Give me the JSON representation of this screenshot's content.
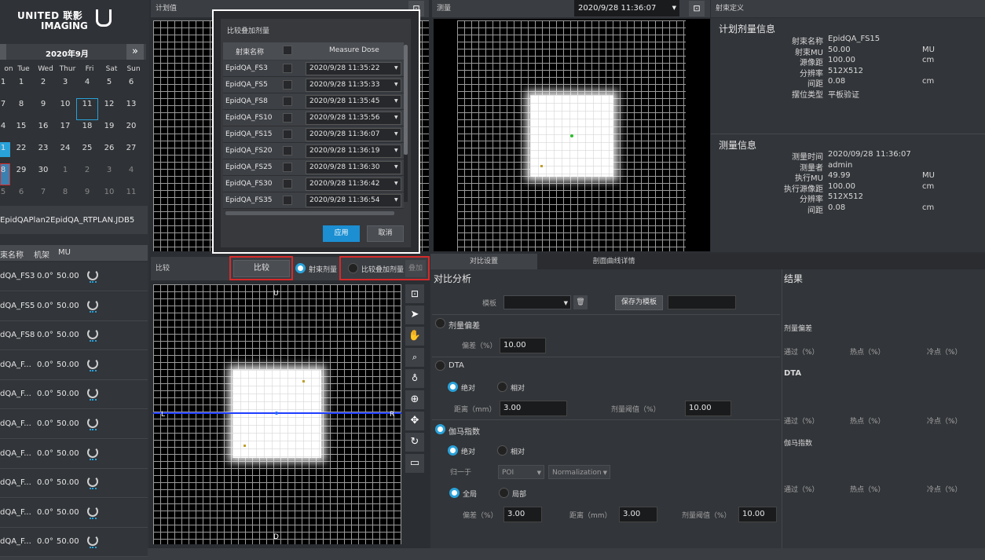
{
  "brand": {
    "line1": "UNITED 联影",
    "line2": "IMAGING"
  },
  "calendar": {
    "month_label": "2020年9月",
    "next_icon": "»",
    "weekdays": [
      "on",
      "Tue",
      "Wed",
      "Thur",
      "Fri",
      "Sat",
      "Sun"
    ],
    "rows": [
      [
        "1",
        "1",
        "2",
        "3",
        "4",
        "5",
        "6"
      ],
      [
        "7",
        "8",
        "9",
        "10",
        "11",
        "12",
        "13"
      ],
      [
        "4",
        "15",
        "16",
        "17",
        "18",
        "19",
        "20"
      ],
      [
        "1",
        "22",
        "23",
        "24",
        "25",
        "26",
        "27"
      ],
      [
        "8",
        "29",
        "30",
        "1",
        "2",
        "3",
        "4"
      ],
      [
        "5",
        "6",
        "7",
        "8",
        "9",
        "10",
        "11"
      ]
    ]
  },
  "plan_file": "EpidQAPlan2EpidQA_RTPLAN.JDB5",
  "beam_table": {
    "headers": [
      "束名称",
      "机架",
      "MU"
    ],
    "rows": [
      {
        "name": "dQA_FS3",
        "gantry": "0.0°",
        "mu": "50.00"
      },
      {
        "name": "dQA_FS5",
        "gantry": "0.0°",
        "mu": "50.00"
      },
      {
        "name": "dQA_FS8",
        "gantry": "0.0°",
        "mu": "50.00"
      },
      {
        "name": "dQA_F...",
        "gantry": "0.0°",
        "mu": "50.00"
      },
      {
        "name": "dQA_F...",
        "gantry": "0.0°",
        "mu": "50.00"
      },
      {
        "name": "dQA_F...",
        "gantry": "0.0°",
        "mu": "50.00"
      },
      {
        "name": "dQA_F...",
        "gantry": "0.0°",
        "mu": "50.00"
      },
      {
        "name": "dQA_F...",
        "gantry": "0.0°",
        "mu": "50.00"
      },
      {
        "name": "dQA_F...",
        "gantry": "0.0°",
        "mu": "50.00"
      },
      {
        "name": "dQA_F...",
        "gantry": "0.0°",
        "mu": "50.00"
      }
    ]
  },
  "panels": {
    "plan_title": "计划值",
    "measure_title": "测量",
    "measure_datetime": "2020/9/28 11:36:07",
    "beam_def_title": "射束定义",
    "compare_title": "比较"
  },
  "plan_info": {
    "title": "计划剂量信息",
    "rows": [
      {
        "label": "射束名称",
        "value": "EpidQA_FS15",
        "unit": ""
      },
      {
        "label": "射束MU",
        "value": "50.00",
        "unit": "MU"
      },
      {
        "label": "源像距",
        "value": "100.00",
        "unit": "cm"
      },
      {
        "label": "分辨率",
        "value": "512X512",
        "unit": ""
      },
      {
        "label": "间距",
        "value": "0.08",
        "unit": "cm"
      },
      {
        "label": "摆位类型",
        "value": "平板验证",
        "unit": ""
      }
    ]
  },
  "measure_info": {
    "title": "测量信息",
    "rows": [
      {
        "label": "测量时间",
        "value": "2020/09/28 11:36:07",
        "unit": ""
      },
      {
        "label": "测量者",
        "value": "admin",
        "unit": ""
      },
      {
        "label": "执行MU",
        "value": "49.99",
        "unit": "MU"
      },
      {
        "label": "执行源像距",
        "value": "100.00",
        "unit": "cm"
      },
      {
        "label": "分辨率",
        "value": "512X512",
        "unit": ""
      },
      {
        "label": "间距",
        "value": "0.08",
        "unit": "cm"
      }
    ]
  },
  "compare_bar": {
    "compare_btn": "比较",
    "beam_dose": "射束剂量",
    "overlay_dose": "比较叠加剂量",
    "overlay_btn": "叠加"
  },
  "image_markers": {
    "top": "U",
    "bottom": "D",
    "left": "L",
    "right": "R"
  },
  "tabs": {
    "compare_settings": "对比设置",
    "profile_details": "剖面曲线详情"
  },
  "analysis": {
    "title": "对比分析",
    "template_label": "模板",
    "save_template": "保存为模板",
    "dose_dev": {
      "title": "剂量偏差",
      "tol_label": "偏差（%）",
      "tol_value": "10.00"
    },
    "dta": {
      "title": "DTA",
      "abs": "绝对",
      "rel": "相对",
      "dist_label": "距离（mm）",
      "dist_value": "3.00",
      "thresh_label": "剂量阈值（%）",
      "thresh_value": "10.00"
    },
    "gamma": {
      "title": "伽马指数",
      "abs": "绝对",
      "rel": "相对",
      "norm_label": "归一于",
      "norm_sel1": "POI",
      "norm_sel2": "Normalization",
      "global": "全局",
      "local": "局部",
      "dev_label": "偏差（%）",
      "dev_value": "3.00",
      "dist_label": "距离（mm）",
      "dist_value": "3.00",
      "thresh_label": "剂量阈值（%）",
      "thresh_value": "10.00"
    }
  },
  "results": {
    "title": "结果",
    "sections": [
      {
        "title": "剂量偏差",
        "pass": "通过（%）",
        "hot": "热点（%）",
        "cold": "冷点（%）"
      },
      {
        "title": "DTA",
        "pass": "通过（%）",
        "hot": "热点（%）",
        "cold": "冷点（%）"
      },
      {
        "title": "伽马指数",
        "pass": "通过（%）",
        "hot": "热点（%）",
        "cold": "冷点（%）"
      }
    ]
  },
  "dialog": {
    "title": "比较叠加剂量",
    "col_name": "射束名称",
    "col_dose": "Measure Dose",
    "rows": [
      {
        "name": "EpidQA_FS3",
        "time": "2020/9/28 11:35:22"
      },
      {
        "name": "EpidQA_FS5",
        "time": "2020/9/28 11:35:33"
      },
      {
        "name": "EpidQA_FS8",
        "time": "2020/9/28 11:35:45"
      },
      {
        "name": "EpidQA_FS10",
        "time": "2020/9/28 11:35:56"
      },
      {
        "name": "EpidQA_FS15",
        "time": "2020/9/28 11:36:07"
      },
      {
        "name": "EpidQA_FS20",
        "time": "2020/9/28 11:36:19"
      },
      {
        "name": "EpidQA_FS25",
        "time": "2020/9/28 11:36:30"
      },
      {
        "name": "EpidQA_FS30",
        "time": "2020/9/28 11:36:42"
      },
      {
        "name": "EpidQA_FS35",
        "time": "2020/9/28 11:36:54"
      }
    ],
    "apply": "应用",
    "cancel": "取消"
  },
  "colors": {
    "accent": "#29a1d9",
    "highlight_red": "#d62a2a",
    "profile_line": "#1e3cff"
  }
}
